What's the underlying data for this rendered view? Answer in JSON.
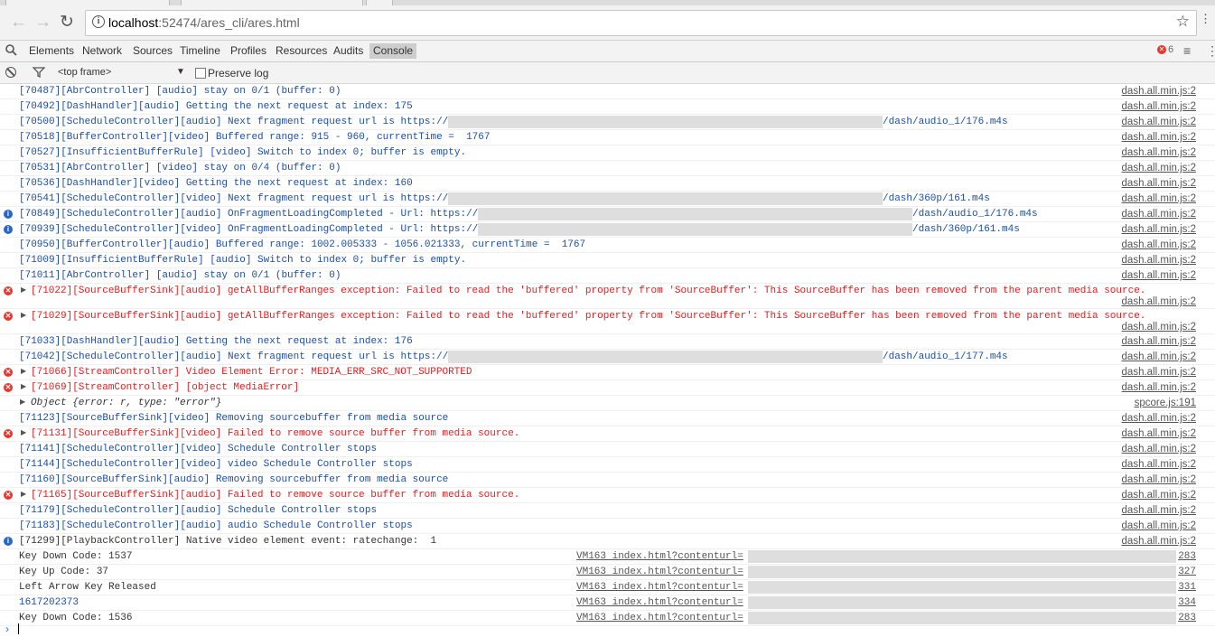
{
  "address": {
    "url_host": "localhost",
    "url_rest": ":52474/ares_cli/ares.html"
  },
  "devtools": {
    "tabs": [
      "Elements",
      "Network",
      "Sources",
      "Timeline",
      "Profiles",
      "Resources",
      "Audits",
      "Console"
    ],
    "selected_tab": "Console",
    "error_count": "6"
  },
  "console_toolbar": {
    "frame": "<top frame>",
    "preserve_log": "Preserve log"
  },
  "rows": [
    {
      "type": "log",
      "msg": "[70487][AbrController] [audio] stay on 0/1 (buffer: 0)",
      "src": "dash.all.min.js:2"
    },
    {
      "type": "log",
      "msg": "[70492][DashHandler][audio] Getting the next request at index: 175",
      "src": "dash.all.min.js:2"
    },
    {
      "type": "log",
      "msg": "[70500][ScheduleController][audio] Next fragment request url is https://",
      "msg2": "/dash/audio_1/176.m4s",
      "src": "dash.all.min.js:2"
    },
    {
      "type": "log",
      "msg": "[70518][BufferController][video] Buffered range: 915 - 960, currentTime =  1767",
      "src": "dash.all.min.js:2"
    },
    {
      "type": "log",
      "msg": "[70527][InsufficientBufferRule] [video] Switch to index 0; buffer is empty.",
      "src": "dash.all.min.js:2"
    },
    {
      "type": "log",
      "msg": "[70531][AbrController] [video] stay on 0/4 (buffer: 0)",
      "src": "dash.all.min.js:2"
    },
    {
      "type": "log",
      "msg": "[70536][DashHandler][video] Getting the next request at index: 160",
      "src": "dash.all.min.js:2"
    },
    {
      "type": "log",
      "msg": "[70541][ScheduleController][video] Next fragment request url is https://",
      "msg2": "/dash/360p/161.m4s",
      "src": "dash.all.min.js:2"
    },
    {
      "type": "info",
      "msg": "[70849][ScheduleController][audio] OnFragmentLoadingCompleted - Url: https://",
      "msg2": "/dash/audio_1/176.m4s",
      "src": "dash.all.min.js:2"
    },
    {
      "type": "info",
      "msg": "[70939][ScheduleController][video] OnFragmentLoadingCompleted - Url: https://",
      "msg2": "/dash/360p/161.m4s",
      "src": "dash.all.min.js:2"
    },
    {
      "type": "log",
      "msg": "[70950][BufferController][audio] Buffered range: 1002.005333 - 1056.021333, currentTime =  1767",
      "src": "dash.all.min.js:2"
    },
    {
      "type": "log",
      "msg": "[71009][InsufficientBufferRule] [audio] Switch to index 0; buffer is empty.",
      "src": "dash.all.min.js:2"
    },
    {
      "type": "log",
      "msg": "[71011][AbrController] [audio] stay on 0/1 (buffer: 0)",
      "src": "dash.all.min.js:2"
    },
    {
      "type": "error_tall",
      "msg": "[71022][SourceBufferSink][audio] getAllBufferRanges exception: Failed to read the 'buffered' property from 'SourceBuffer': This SourceBuffer has been removed from the parent media source.",
      "src": "dash.all.min.js:2"
    },
    {
      "type": "error_tall",
      "msg": "[71029][SourceBufferSink][audio] getAllBufferRanges exception: Failed to read the 'buffered' property from 'SourceBuffer': This SourceBuffer has been removed from the parent media source.",
      "src": "dash.all.min.js:2"
    },
    {
      "type": "log",
      "msg": "[71033][DashHandler][audio] Getting the next request at index: 176",
      "src": "dash.all.min.js:2"
    },
    {
      "type": "log",
      "msg": "[71042][ScheduleController][audio] Next fragment request url is https://",
      "msg2": "/dash/audio_1/177.m4s",
      "src": "dash.all.min.js:2"
    },
    {
      "type": "error",
      "msg": "[71066][StreamController] Video Element Error: MEDIA_ERR_SRC_NOT_SUPPORTED",
      "src": "dash.all.min.js:2"
    },
    {
      "type": "error",
      "msg": "[71069][StreamController] [object MediaError]",
      "src": "dash.all.min.js:2"
    },
    {
      "type": "obj",
      "msg": "Object {error: r, type: \"error\"}",
      "src": "spcore.js:191"
    },
    {
      "type": "log",
      "msg": "[71123][SourceBufferSink][video] Removing sourcebuffer from media source",
      "src": "dash.all.min.js:2"
    },
    {
      "type": "error",
      "msg": "[71131][SourceBufferSink][video] Failed to remove source buffer from media source.",
      "src": "dash.all.min.js:2"
    },
    {
      "type": "log",
      "msg": "[71141][ScheduleController][video] Schedule Controller stops",
      "src": "dash.all.min.js:2"
    },
    {
      "type": "log",
      "msg": "[71144][ScheduleController][video] video Schedule Controller stops",
      "src": "dash.all.min.js:2"
    },
    {
      "type": "log",
      "msg": "[71160][SourceBufferSink][audio] Removing sourcebuffer from media source",
      "src": "dash.all.min.js:2"
    },
    {
      "type": "error",
      "msg": "[71165][SourceBufferSink][audio] Failed to remove source buffer from media source.",
      "src": "dash.all.min.js:2"
    },
    {
      "type": "log",
      "msg": "[71179][ScheduleController][audio] Schedule Controller stops",
      "src": "dash.all.min.js:2"
    },
    {
      "type": "log",
      "msg": "[71183][ScheduleController][audio] audio Schedule Controller stops",
      "src": "dash.all.min.js:2"
    },
    {
      "type": "info_plain",
      "msg": "[71299][PlaybackController] Native video element event: ratechange:  1",
      "src": "dash.all.min.js:2"
    },
    {
      "type": "vm",
      "msg": "Key Down Code: 1537",
      "vm": "VM163 index.html?contenturl=",
      "line": "283"
    },
    {
      "type": "vm",
      "msg": "Key Up Code: 37",
      "vm": "VM163 index.html?contenturl=",
      "line": "327"
    },
    {
      "type": "vm",
      "msg": "Left Arrow Key Released",
      "vm": "VM163 index.html?contenturl=",
      "line": "331"
    },
    {
      "type": "vm_blue",
      "msg": "1617202373",
      "vm": "VM163 index.html?contenturl=",
      "line": "334"
    },
    {
      "type": "vm",
      "msg": "Key Down Code: 1536",
      "vm": "VM163 index.html?contenturl=",
      "line": "283"
    }
  ]
}
